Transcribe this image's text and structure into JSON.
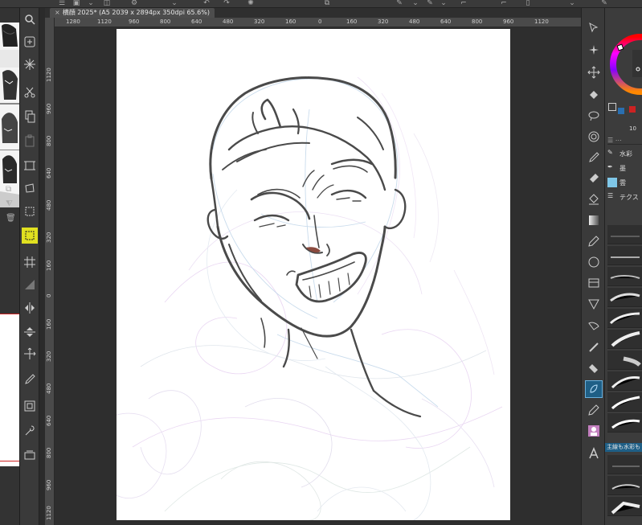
{
  "document": {
    "tab_title": "横顔 2025* (A5 2039 x 2894px 350dpi 65.6%)",
    "close_glyph": "×"
  },
  "ruler_top": [
    "1280",
    "1120",
    "960",
    "800",
    "640",
    "480",
    "320",
    "160",
    "0",
    "160",
    "320",
    "480",
    "640",
    "800",
    "960",
    "1120"
  ],
  "ruler_left": [
    "1120",
    "960",
    "800",
    "640",
    "480",
    "320",
    "160",
    "0",
    "160",
    "320",
    "480",
    "640",
    "800",
    "960",
    "1120"
  ],
  "left_toolbar": [
    "magnifier",
    "move-hand",
    "auto-select",
    "brush-sparkle",
    "cut",
    "copy",
    "paste",
    "frame-border",
    "transform",
    "rect-select",
    "lasso-select",
    "grid",
    "gradient",
    "flip-horizontal",
    "flip-vertical",
    "move-layer",
    "eyedropper",
    "layer-property",
    "settings-wrench",
    "scan"
  ],
  "right_toolbar": [
    "operation",
    "sparkle",
    "move",
    "fill",
    "lasso",
    "spiral",
    "eyedropper",
    "brush-fill",
    "fill-bucket",
    "gradient-square",
    "pen",
    "ellipse",
    "ruler-frame",
    "triangle",
    "gradient",
    "correction",
    "eraser",
    "pen-active",
    "pencil",
    "avatar",
    "text"
  ],
  "right_panel": {
    "value_label": "10",
    "brushes": [
      {
        "label": "水彩",
        "icon": "brush-icon"
      },
      {
        "label": "墨",
        "icon": "ink-icon"
      },
      {
        "label": "雲",
        "icon": "cloud-icon"
      },
      {
        "label": "テクス",
        "icon": "texture-icon"
      }
    ],
    "preset_label": "主線も水彩も"
  },
  "colors": {
    "accent": "#1f5f86",
    "highlight": "#e0e020",
    "canvas": "#ffffff",
    "ink": "#4a4a4a"
  }
}
